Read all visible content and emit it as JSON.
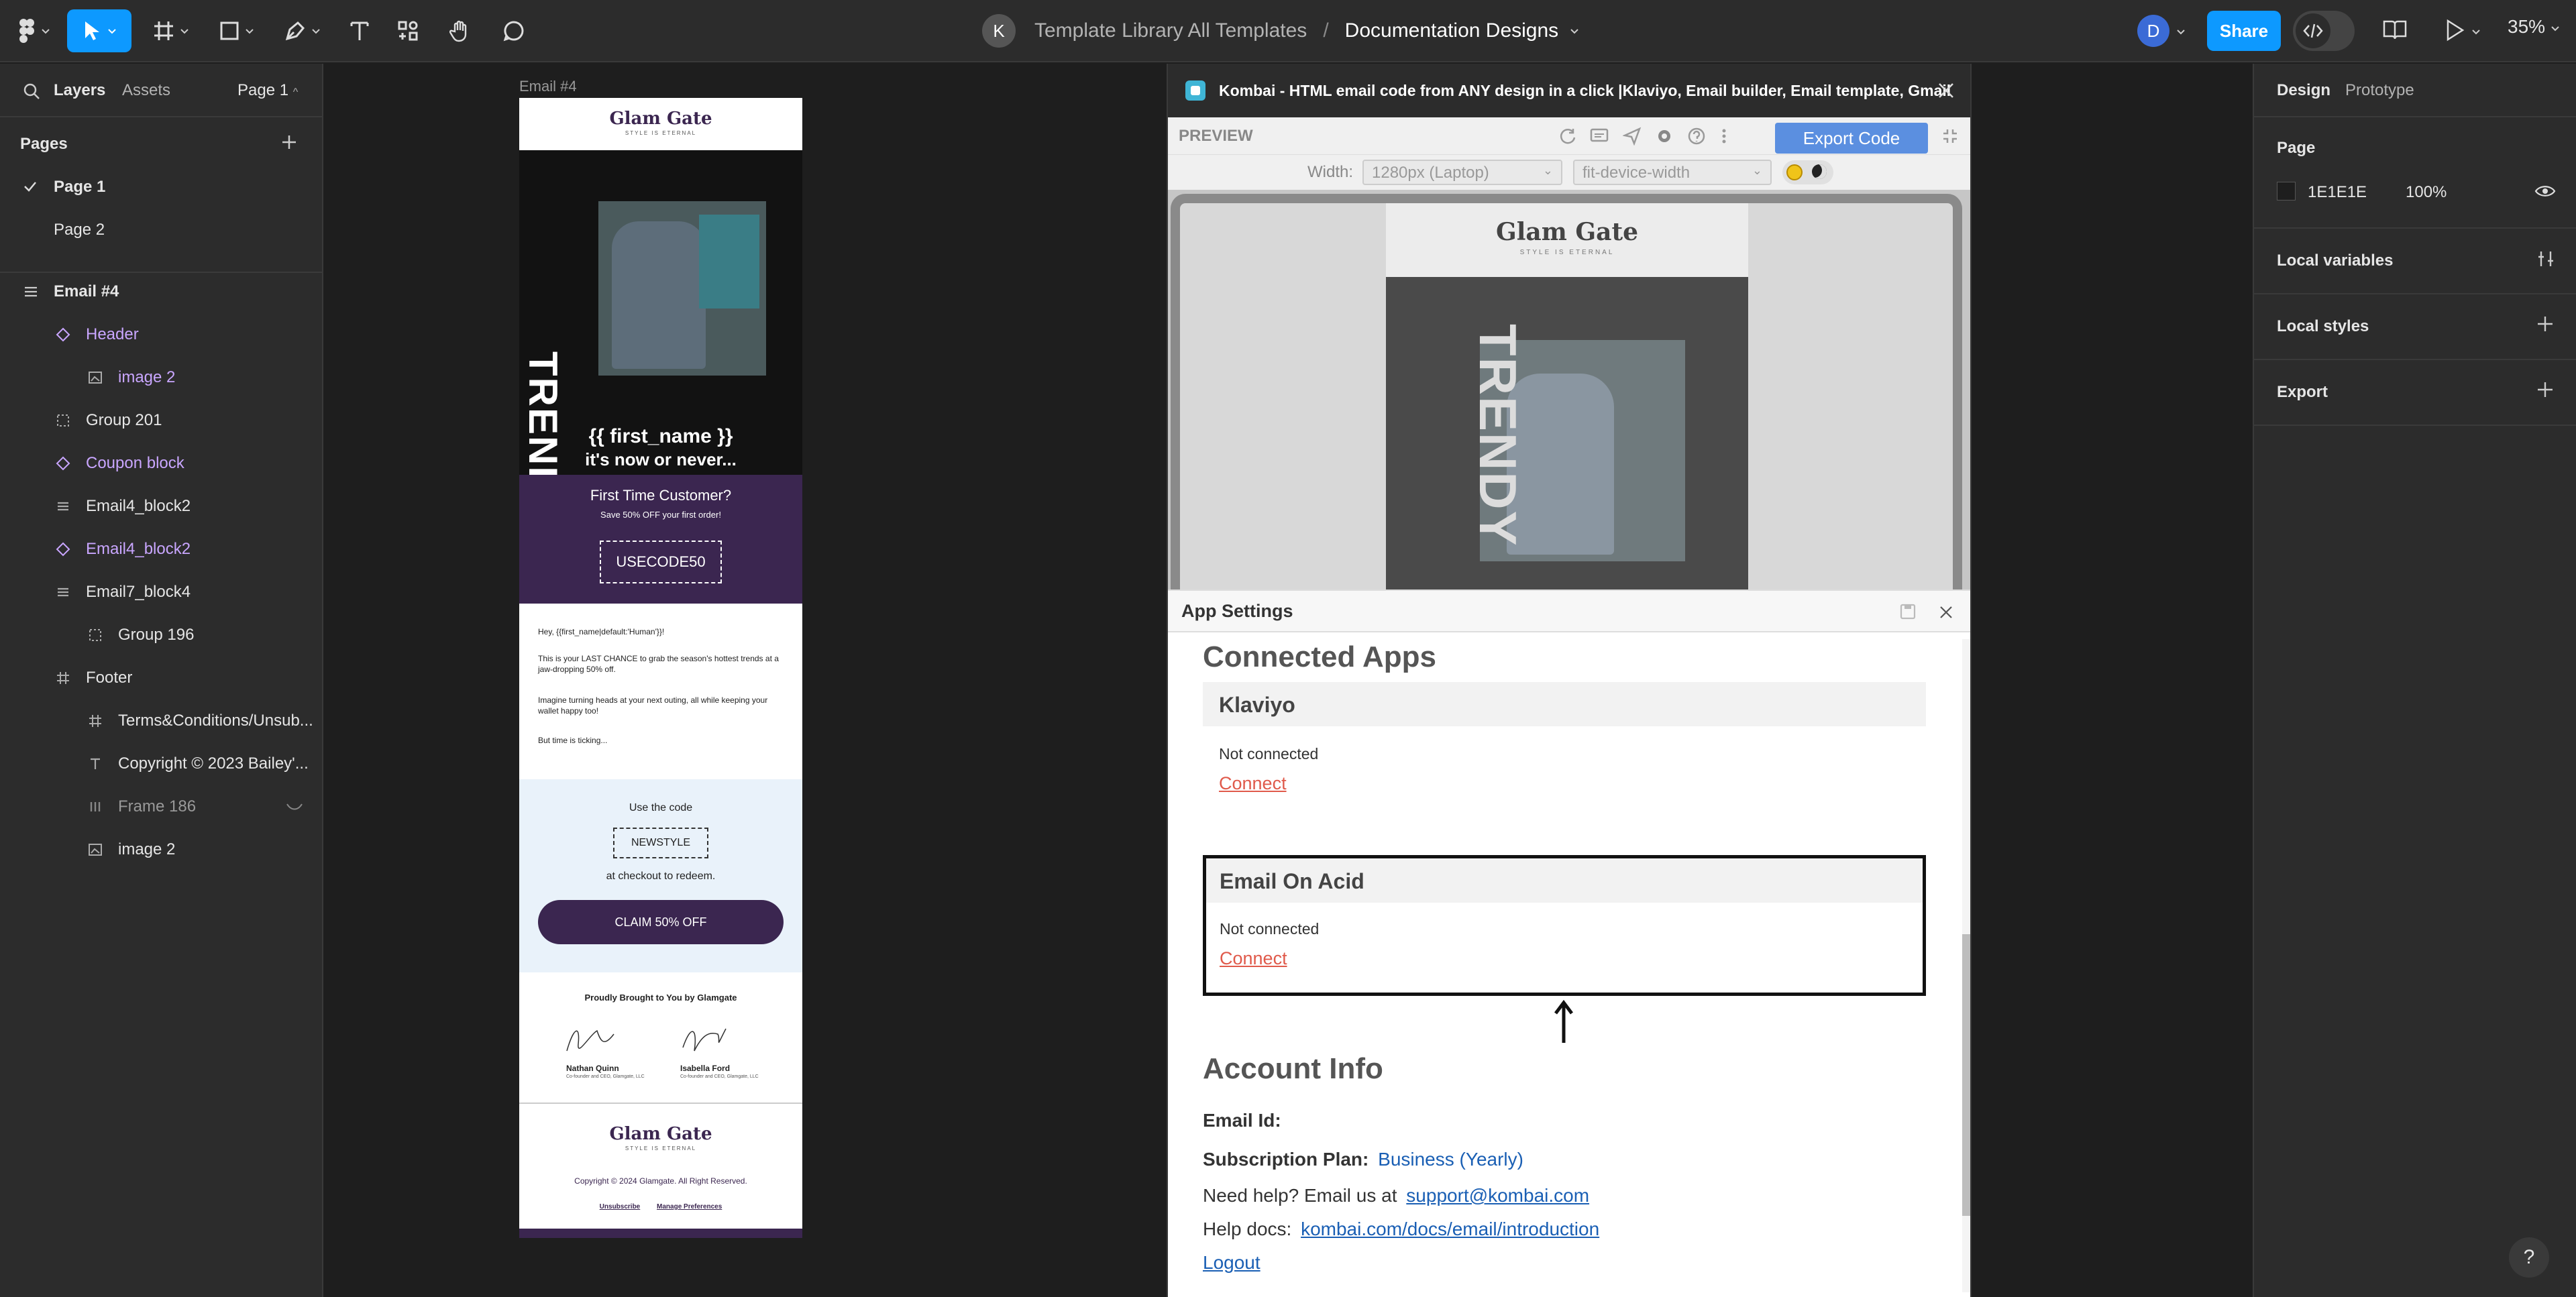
{
  "toolbar": {
    "project_initial": "K",
    "project_name": "Template Library All Templates",
    "separator": "/",
    "file_name": "Documentation Designs",
    "user_initial": "D",
    "share_label": "Share",
    "zoom": "35%"
  },
  "left_panel": {
    "tab_layers": "Layers",
    "tab_assets": "Assets",
    "page_selector": "Page 1",
    "pages_heading": "Pages",
    "pages": [
      {
        "label": "Page 1",
        "active": true
      },
      {
        "label": "Page 2",
        "active": false
      }
    ],
    "layers": [
      {
        "label": "Email #4",
        "icon": "frame-stack-icon",
        "indent": 0,
        "component": false
      },
      {
        "label": "Header",
        "icon": "component-icon",
        "indent": 1,
        "component": true
      },
      {
        "label": "image 2",
        "icon": "image-icon",
        "indent": 2,
        "component": true
      },
      {
        "label": "Group 201",
        "icon": "group-icon",
        "indent": 1,
        "component": false
      },
      {
        "label": "Coupon block",
        "icon": "component-icon",
        "indent": 1,
        "component": true
      },
      {
        "label": "Email4_block2",
        "icon": "auto-layout-icon",
        "indent": 1,
        "component": false
      },
      {
        "label": "Email4_block2",
        "icon": "component-icon",
        "indent": 1,
        "component": true
      },
      {
        "label": "Email7_block4",
        "icon": "auto-layout-icon",
        "indent": 1,
        "component": false
      },
      {
        "label": "Group 196",
        "icon": "group-icon",
        "indent": 2,
        "component": false
      },
      {
        "label": "Footer",
        "icon": "frame-icon",
        "indent": 1,
        "component": false
      },
      {
        "label": "Terms&Conditions/Unsub...",
        "icon": "frame-icon",
        "indent": 2,
        "component": false
      },
      {
        "label": "Copyright © 2023 Bailey'...",
        "icon": "text-icon",
        "indent": 2,
        "component": false
      },
      {
        "label": "Frame 186",
        "icon": "columns-icon",
        "indent": 2,
        "component": false
      },
      {
        "label": "image 2",
        "icon": "image-icon",
        "indent": 2,
        "component": false
      }
    ]
  },
  "canvas": {
    "frame_label": "Email #4",
    "email": {
      "brand": "Glam Gate",
      "tagline": "STYLE IS ETERNAL",
      "hero_word": "TRENDY",
      "greeting_line1": "{{ first_name }}",
      "greeting_line2": "it's now or never...",
      "offer_title": "First Time Customer?",
      "offer_sub": "Save 50% OFF your first order!",
      "offer_code": "USECODE50",
      "body_p1": "Hey, {{first_name|default:'Human'}}!",
      "body_p2": "This is your LAST CHANCE to grab the season's hottest trends at a jaw-dropping 50% off.",
      "body_p3": "Imagine turning heads at your next outing, all while keeping your wallet happy too!",
      "body_p4": "But time is ticking...",
      "code_intro": "Use the code",
      "code": "NEWSTYLE",
      "code_outro": "at checkout to redeem.",
      "cta": "CLAIM 50% OFF",
      "signoff": "Proudly Brought to You by Glamgate",
      "signer1_name": "Nathan Quinn",
      "signer1_role": "Co-founder and CEO, Glamgate, LLC",
      "signer2_name": "Isabella Ford",
      "signer2_role": "Co-founder and CEO, Glamgate, LLC",
      "footer_brand": "Glam Gate",
      "footer_tagline": "STYLE IS ETERNAL",
      "copyright": "Copyright © 2024 Glamgate. All Right Reserved.",
      "link_unsubscribe": "Unsubscribe",
      "link_preferences": "Manage Preferences"
    }
  },
  "plugin": {
    "title": "Kombai - HTML email code from ANY design in a click |Klaviyo, Email builder, Email template, Gmail",
    "preview_label": "PREVIEW",
    "export_label": "Export Code",
    "width_label": "Width:",
    "width_value": "1280px (Laptop)",
    "fit_value": "fit-device-width",
    "preview_brand": "Glam Gate",
    "preview_tagline": "STYLE IS ETERNAL",
    "preview_hero_word": "TRENDY",
    "settings": {
      "title": "App Settings",
      "connected_apps_heading": "Connected Apps",
      "apps": [
        {
          "name": "Klaviyo",
          "status": "Not connected",
          "action": "Connect"
        },
        {
          "name": "Email On Acid",
          "status": "Not connected",
          "action": "Connect"
        }
      ],
      "account_heading": "Account Info",
      "email_label": "Email Id:",
      "plan_label": "Subscription Plan:",
      "plan_value": "Business (Yearly)",
      "help_text": "Need help? Email us at",
      "help_email": "support@kombai.com",
      "docs_text": "Help docs:",
      "docs_link": "kombai.com/docs/email/introduction",
      "logout": "Logout"
    }
  },
  "right_panel": {
    "tab_design": "Design",
    "tab_prototype": "Prototype",
    "page_heading": "Page",
    "bg_hex": "1E1E1E",
    "bg_opacity": "100%",
    "local_variables": "Local variables",
    "local_styles": "Local styles",
    "export": "Export"
  },
  "help_button": "?",
  "colors": {
    "accent": "#0d99ff",
    "email_purple": "#3b2650",
    "email_dark": "#121212",
    "link_red": "#e05a4b",
    "link_blue": "#1a5fb4"
  }
}
